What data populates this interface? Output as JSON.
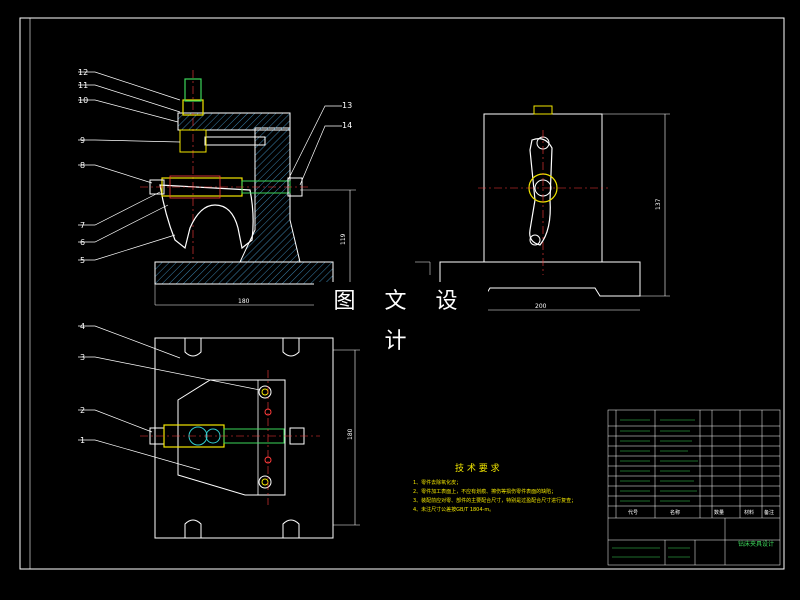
{
  "watermark": "图 文 设 计",
  "front_view": {
    "balloons": [
      "12",
      "11",
      "10",
      "9",
      "8",
      "7",
      "6",
      "5",
      "13",
      "14"
    ],
    "dim_width": "180",
    "dim_height": "119"
  },
  "side_view": {
    "dim_width": "200",
    "dim_height": "137"
  },
  "top_view": {
    "balloons": [
      "4",
      "3",
      "2",
      "1"
    ],
    "dim_height": "180"
  },
  "tech_requirements": {
    "title": "技 术 要 求",
    "items": [
      "1、零件去除氧化皮；",
      "2、零件加工表面上，不应有划痕、擦伤等损伤零件表面的缺陷；",
      "3、装配前应对零、部件的主要配合尺寸，特别是过盈配合尺寸进行复查；",
      "4、未注尺寸公差按GB/T 1804-m。"
    ]
  },
  "title_block": {
    "drawing_title": "钻床夹具设计",
    "header_code": "代号",
    "header_name": "名称",
    "header_qty": "数量",
    "header_material": "材料",
    "header_note": "备注"
  },
  "colors": {
    "outline": "#ffffff",
    "center_line": "#ff3b3b",
    "hatch": "#4aa3d8",
    "part_yellow": "#f2e600",
    "part_green": "#3cd65a",
    "part_cyan": "#33cccc"
  }
}
